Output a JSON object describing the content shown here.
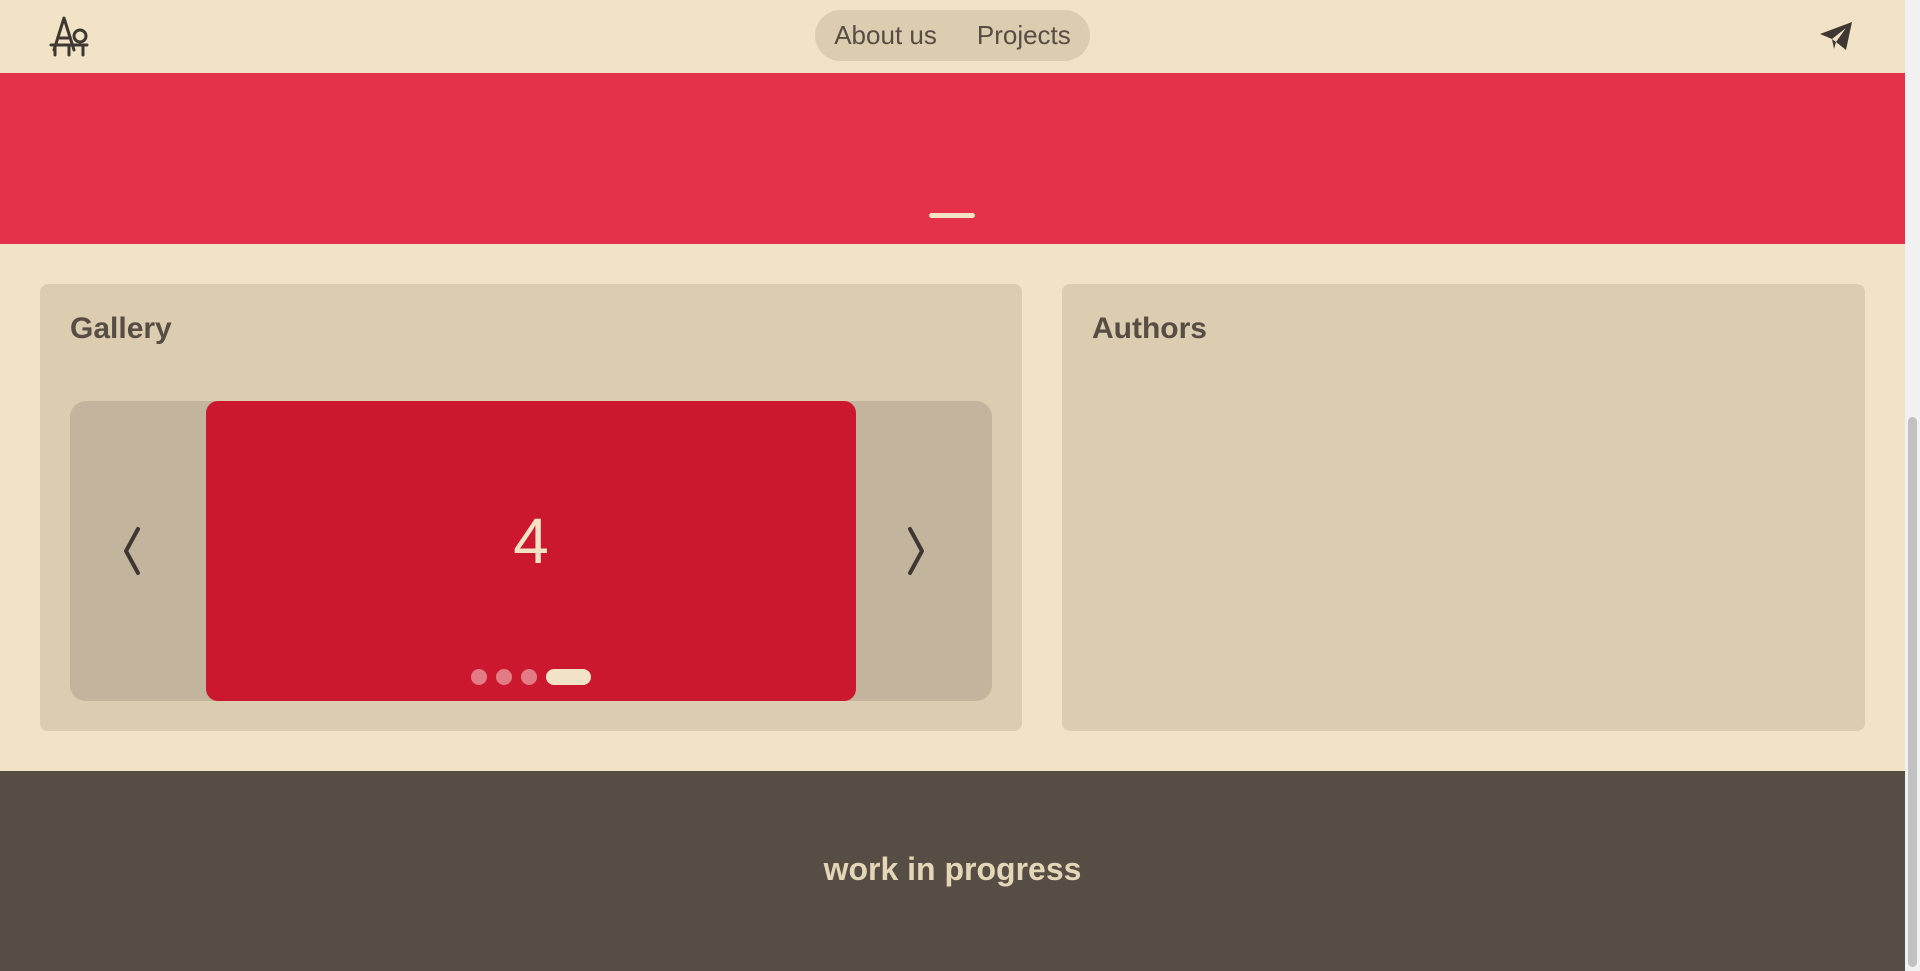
{
  "header": {
    "logo_icon": "architect-logo-icon",
    "nav": {
      "items": [
        {
          "label": "About us"
        },
        {
          "label": "Projects"
        }
      ]
    },
    "contact_icon": "paper-plane-icon"
  },
  "hero": {
    "color": "#e5324b",
    "slide_count": 1,
    "active_slide": 1
  },
  "gallery": {
    "title": "Gallery",
    "prev_icon": "chevron-left-icon",
    "next_icon": "chevron-right-icon",
    "current_slide_label": "4",
    "slide_color": "#cc182e",
    "slide_count": 4,
    "active_slide": 4
  },
  "authors": {
    "title": "Authors"
  },
  "footer": {
    "text": "work in progress"
  },
  "colors": {
    "background": "#f2e3c6",
    "card": "#dccdb1",
    "text": "#564d44",
    "footer": "#564e45"
  }
}
